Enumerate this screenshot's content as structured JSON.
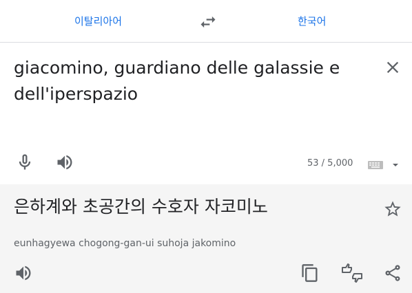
{
  "languages": {
    "source": "이탈리아어",
    "target": "한국어"
  },
  "source": {
    "text": "giacomino, guardiano delle galassie e dell'iperspazio",
    "char_count": "53 / 5,000"
  },
  "target": {
    "text": "은하계와 초공간의 수호자 자코미노",
    "transliteration": "eunhagyewa chogong-gan-ui suhoja jakomino"
  },
  "icons": {
    "swap": "swap-icon",
    "clear": "close-icon",
    "mic": "microphone-icon",
    "speaker": "speaker-icon",
    "keyboard": "keyboard-icon",
    "star": "star-icon",
    "copy": "copy-icon",
    "rate": "thumbs-rate-icon",
    "share": "share-icon"
  },
  "colors": {
    "accent": "#1a73e8",
    "icon": "#5f6368",
    "target_bg": "#f5f5f5"
  }
}
